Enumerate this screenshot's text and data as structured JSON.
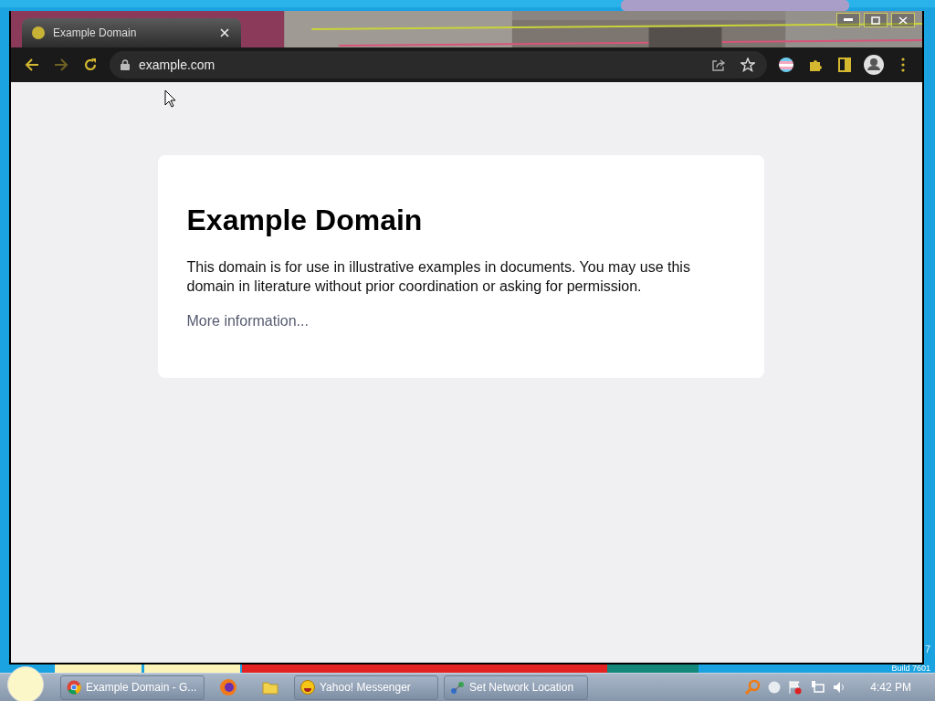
{
  "desktop": {
    "texts": [
      "7",
      "Build 7601"
    ]
  },
  "browser": {
    "tab": {
      "title": "Example Domain"
    },
    "forward": {
      "disabled": true
    },
    "address": "example.com",
    "page": {
      "heading": "Example Domain",
      "text": "This domain is for use in illustrative examples in documents. You may use this domain in literature without prior coordination or asking for permission.",
      "link": "More information..."
    }
  },
  "taskbar": {
    "items": [
      {
        "kind": "window",
        "label": "Example Domain - G..."
      },
      {
        "kind": "pinned"
      },
      {
        "kind": "pinned"
      },
      {
        "kind": "window",
        "label": "Yahoo! Messenger"
      },
      {
        "kind": "window",
        "label": "Set Network Location"
      }
    ],
    "clock": "4:42 PM"
  }
}
